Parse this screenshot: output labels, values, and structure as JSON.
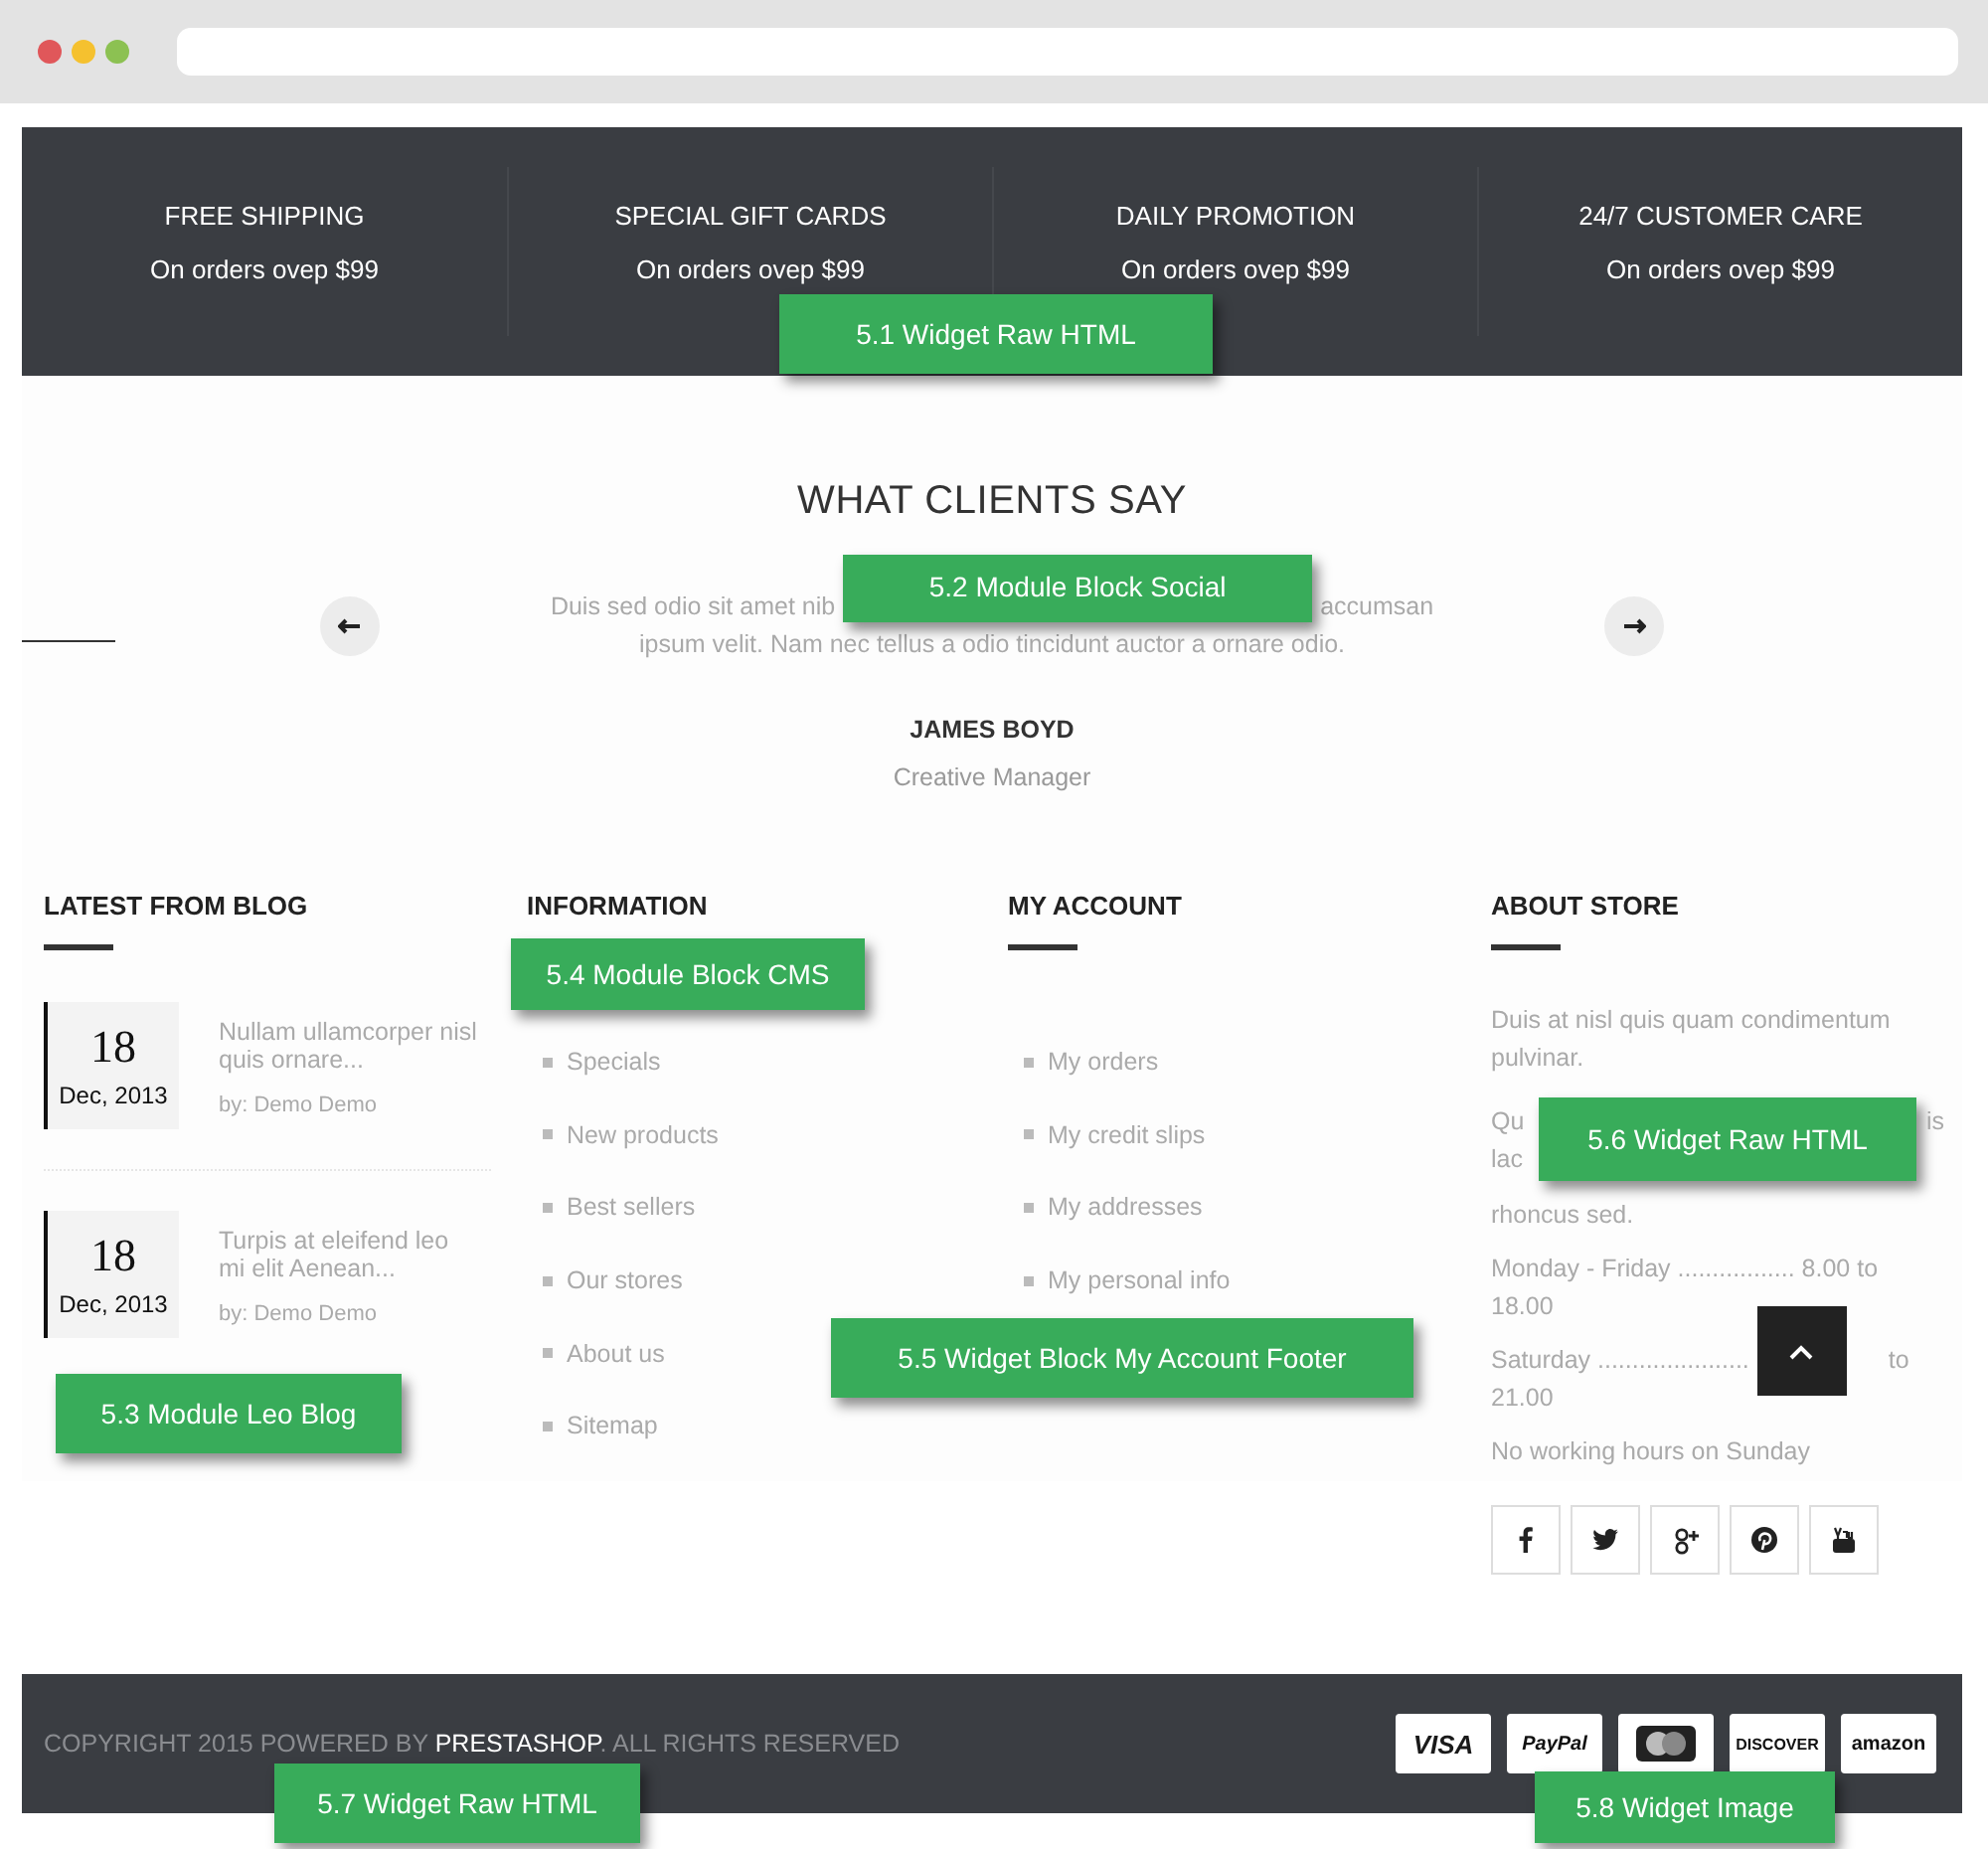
{
  "features": {
    "items": [
      {
        "title": "FREE SHIPPING",
        "subtitle": "On orders ovep $99"
      },
      {
        "title": "SPECIAL GIFT CARDS",
        "subtitle": "On orders ovep $99"
      },
      {
        "title": "DAILY PROMOTION",
        "subtitle": "On orders ovep $99"
      },
      {
        "title": "24/7 CUSTOMER CARE",
        "subtitle": "On orders ovep $99"
      }
    ],
    "annotation": "5.1 Widget Raw HTML"
  },
  "testimonials": {
    "title": "WHAT CLIENTS SAY",
    "quote_line_1_left": "Duis sed odio sit amet nib",
    "quote_line_1_right": "accumsan",
    "quote_line_2": "ipsum velit. Nam nec tellus a odio tincidunt auctor a ornare odio.",
    "name": "JAMES BOYD",
    "role": "Creative Manager",
    "annotation": "5.2 Module Block Social"
  },
  "blog": {
    "heading": "LATEST FROM BLOG",
    "posts": [
      {
        "day": "18",
        "month_year": "Dec, 2013",
        "title": "Nullam ullamcorper nisl quis ornare...",
        "author": "by: Demo Demo"
      },
      {
        "day": "18",
        "month_year": "Dec, 2013",
        "title": "Turpis at eleifend leo mi elit Aenean...",
        "author": "by: Demo Demo"
      }
    ],
    "annotation": "5.3 Module Leo Blog"
  },
  "information": {
    "heading": "INFORMATION",
    "items": [
      "Specials",
      "New products",
      "Best sellers",
      "Our stores",
      "About us",
      "Sitemap"
    ],
    "annotation": "5.4 Module Block CMS"
  },
  "my_account": {
    "heading": "MY ACCOUNT",
    "items": [
      "My orders",
      "My credit slips",
      "My addresses",
      "My personal info"
    ],
    "annotation": "5.5 Widget Block My Account Footer"
  },
  "about_store": {
    "heading": "ABOUT STORE",
    "intro": "Duis at nisl quis quam condimentum pulvinar.",
    "partial_left": [
      "Qu",
      "lac"
    ],
    "partial_right": "is",
    "continued": "rhoncus sed.",
    "weekday_hours": "Monday - Friday ................. 8.00 to 18.00",
    "saturday_left": "Saturday ......................",
    "saturday_right": "to",
    "saturday_continued": "21.00",
    "note": "No working hours on Sunday",
    "annotation": "5.6 Widget Raw HTML"
  },
  "footer": {
    "copyright_before": "COPYRIGHT 2015 POWERED BY ",
    "brand_link": "PRESTASHOP",
    "copyright_after": ". ALL RIGHTS RESERVED",
    "payments": [
      {
        "kind": "visa",
        "label": "VISA"
      },
      {
        "kind": "paypal",
        "label": "PayPal"
      },
      {
        "kind": "mastercard"
      },
      {
        "kind": "discover",
        "label": "DISCOVER"
      },
      {
        "kind": "amazon",
        "label": "amazon"
      }
    ],
    "annotation_left": "5.7 Widget Raw HTML",
    "annotation_right": "5.8 Widget Image"
  }
}
